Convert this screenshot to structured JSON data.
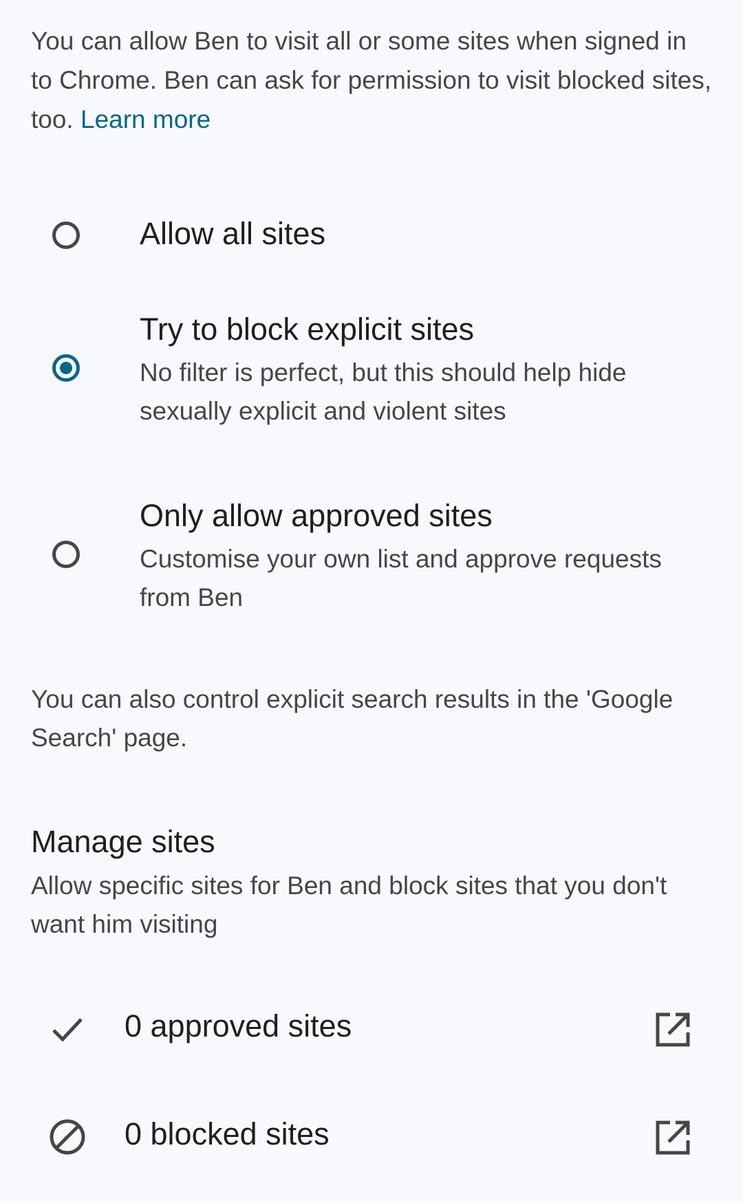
{
  "intro": {
    "text": "You can allow Ben to visit all or some sites when signed in to Chrome. Ben can ask for permission to visit blocked sites, too. ",
    "link": "Learn more"
  },
  "options": [
    {
      "title": "Allow all sites",
      "subtitle": "",
      "selected": false
    },
    {
      "title": "Try to block explicit sites",
      "subtitle": "No filter is perfect, but this should help hide sexually explicit and violent sites",
      "selected": true
    },
    {
      "title": "Only allow approved sites",
      "subtitle": "Customise your own list and approve requests from Ben",
      "selected": false
    }
  ],
  "note": "You can also control explicit search results in the 'Google Search' page.",
  "manage": {
    "title": "Manage sites",
    "subtitle": "Allow specific sites for Ben and block sites that you don't want him visiting",
    "rows": [
      {
        "label": "0 approved sites",
        "icon": "check-icon",
        "action_icon": "open-in-new-icon"
      },
      {
        "label": "0 blocked sites",
        "icon": "block-icon",
        "action_icon": "open-in-new-icon"
      }
    ]
  },
  "colors": {
    "accent": "#0b6683",
    "background": "#f8f9fd",
    "text_primary": "#1f1f1f",
    "text_secondary": "#444746"
  }
}
